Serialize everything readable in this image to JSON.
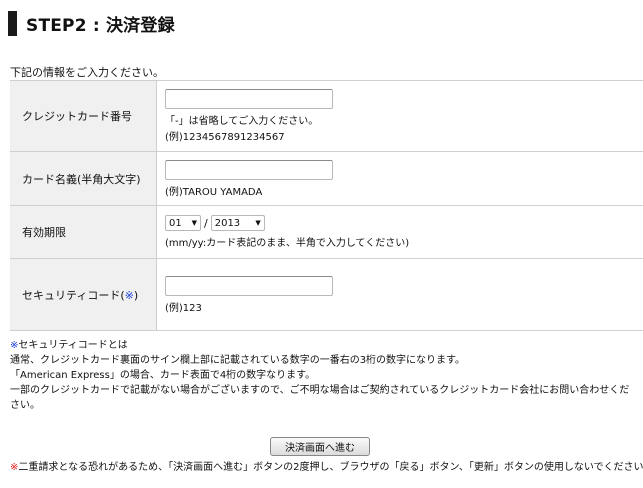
{
  "header": {
    "title": "STEP2 : 決済登録"
  },
  "intro": "下記の情報をご入力ください。",
  "card_number": {
    "label": "クレジットカード番号",
    "value": "",
    "hint": "「-」は省略してご入力ください。",
    "example": "(例)1234567891234567"
  },
  "card_name": {
    "label": "カード名義(半角大文字)",
    "value": "",
    "example": "(例)TAROU YAMADA"
  },
  "expiry": {
    "label": "有効期限",
    "month": "01",
    "separator": "/",
    "year": "2013",
    "hint": "(mm/yy:カード表記のまま、半角で入力してください)"
  },
  "security_code": {
    "label": "セキュリティコード(",
    "mark": "※",
    "label_end": ")",
    "value": "",
    "example": "(例)123"
  },
  "notes": {
    "mark": "※",
    "heading": "セキュリティコードとは",
    "line1": "通常、クレジットカード裏面のサイン欄上部に記載されている数字の一番右の3桁の数字になります。",
    "line2": "「American Express」の場合、カード表面で4桁の数字なります。",
    "line3": "一部のクレジットカードで記載がない場合がございますので、ご不明な場合はご契約されているクレジットカード会社にお問い合わせください。"
  },
  "submit_label": "決済画面へ進む",
  "warning": {
    "mark": "※",
    "text": "二重請求となる恐れがあるため、「決済画面へ進む」ボタンの2度押し、ブラウザの「戻る」ボタン、「更新」ボタンの使用しないでください。"
  },
  "colors": {
    "accent_blue": "#1a3fd6",
    "warning_red": "#e02020",
    "label_bg": "#f0f0f0"
  }
}
